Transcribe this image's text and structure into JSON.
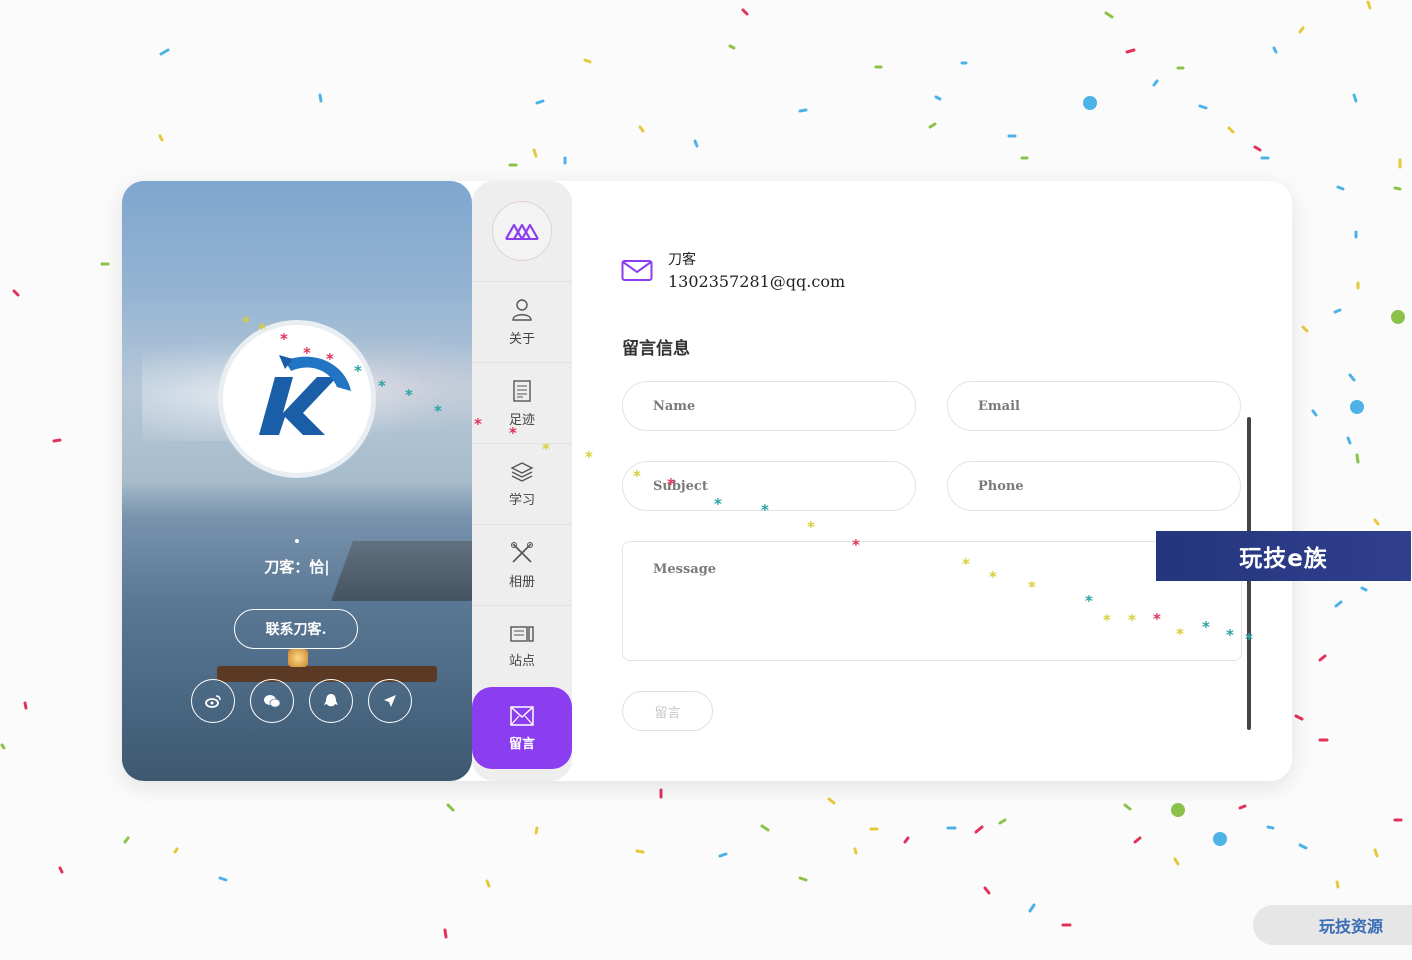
{
  "profile": {
    "typing_text": "刀客：恰|",
    "contact_button": "联系刀客.",
    "social_icons": [
      "weibo-icon",
      "wechat-icon",
      "qq-icon",
      "location-icon"
    ]
  },
  "nav": {
    "items": [
      {
        "label": "关于",
        "icon": "user-icon"
      },
      {
        "label": "足迹",
        "icon": "document-icon"
      },
      {
        "label": "学习",
        "icon": "layers-icon"
      },
      {
        "label": "相册",
        "icon": "tools-icon"
      },
      {
        "label": "站点",
        "icon": "site-icon"
      },
      {
        "label": "留言",
        "icon": "message-icon",
        "active": true
      }
    ]
  },
  "contact": {
    "name": "刀客",
    "email": "1302357281@qq.com"
  },
  "form": {
    "title": "留言信息",
    "name_placeholder": "Name",
    "email_placeholder": "Email",
    "subject_placeholder": "Subject",
    "phone_placeholder": "Phone",
    "message_placeholder": "Message",
    "submit_label": "留言"
  },
  "overlay": {
    "banner": "玩技e族",
    "pill": "玩技资源"
  },
  "colors": {
    "accent": "#8b3df0",
    "banner_bg": "#2b3a86"
  }
}
